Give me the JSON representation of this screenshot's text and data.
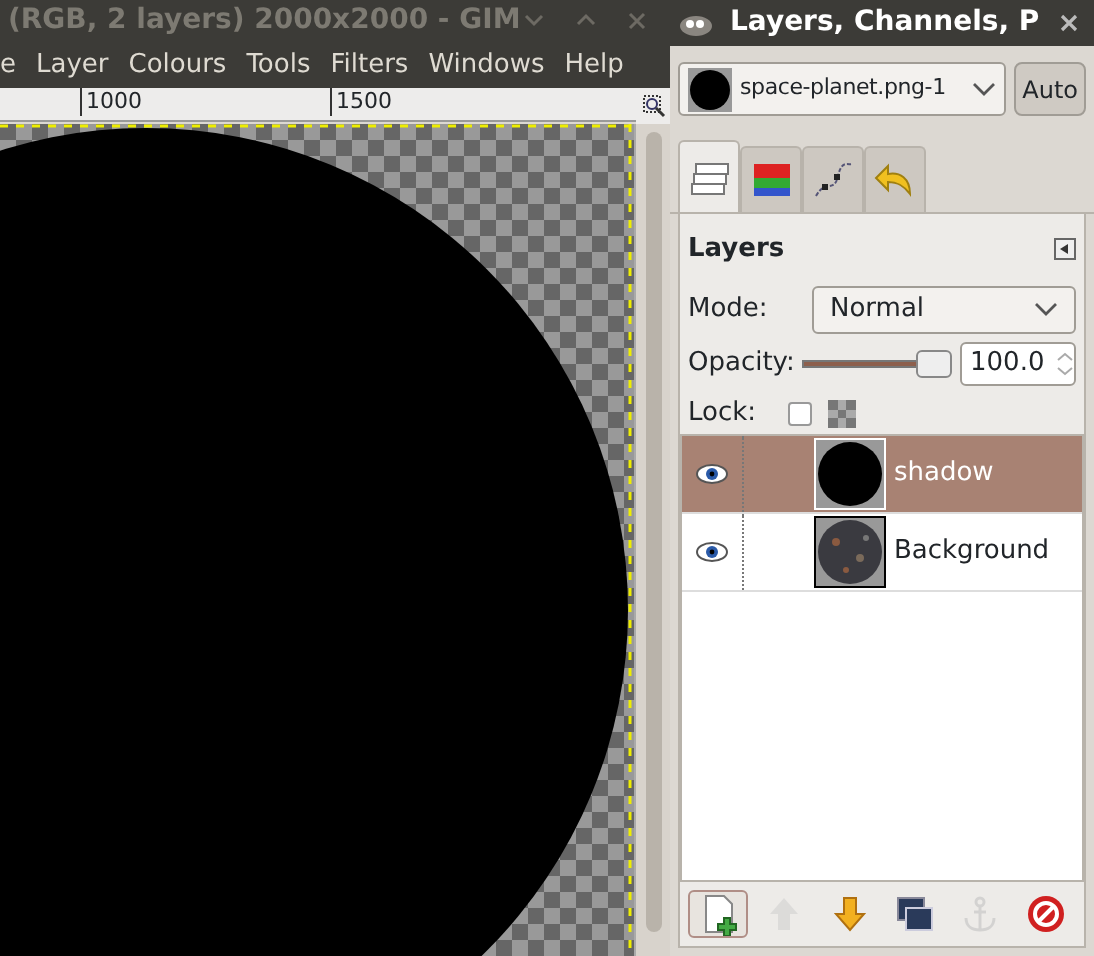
{
  "image_window": {
    "title": "(RGB, 2 layers) 2000x2000 - GIM",
    "menu": [
      "e",
      "Layer",
      "Colours",
      "Tools",
      "Filters",
      "Windows",
      "Help"
    ],
    "ruler_labels": [
      "1000",
      "1500"
    ]
  },
  "dock": {
    "title": "Layers, Channels, P",
    "image_menu": {
      "value": "space-planet.png-1"
    },
    "auto_button": "Auto",
    "tabs": [
      {
        "kind": "layers",
        "selected": true
      },
      {
        "kind": "channels",
        "selected": false
      },
      {
        "kind": "paths",
        "selected": false
      },
      {
        "kind": "undo",
        "selected": false
      }
    ],
    "panel_title": "Layers",
    "mode": {
      "label": "Mode:",
      "value": "Normal"
    },
    "opacity": {
      "label": "Opacity:",
      "level": 1.0,
      "value": "100.0"
    },
    "lock": {
      "label": "Lock:",
      "checked": false
    },
    "layers": [
      {
        "name": "shadow",
        "visible": true,
        "selected": true,
        "kind": "disc"
      },
      {
        "name": "Background",
        "visible": true,
        "selected": false,
        "kind": "texture"
      }
    ],
    "buttons": [
      {
        "kind": "new",
        "disabled": false
      },
      {
        "kind": "raise",
        "disabled": true
      },
      {
        "kind": "lower",
        "disabled": false
      },
      {
        "kind": "duplicate",
        "disabled": false
      },
      {
        "kind": "anchor",
        "disabled": true
      },
      {
        "kind": "delete",
        "disabled": false
      }
    ]
  }
}
